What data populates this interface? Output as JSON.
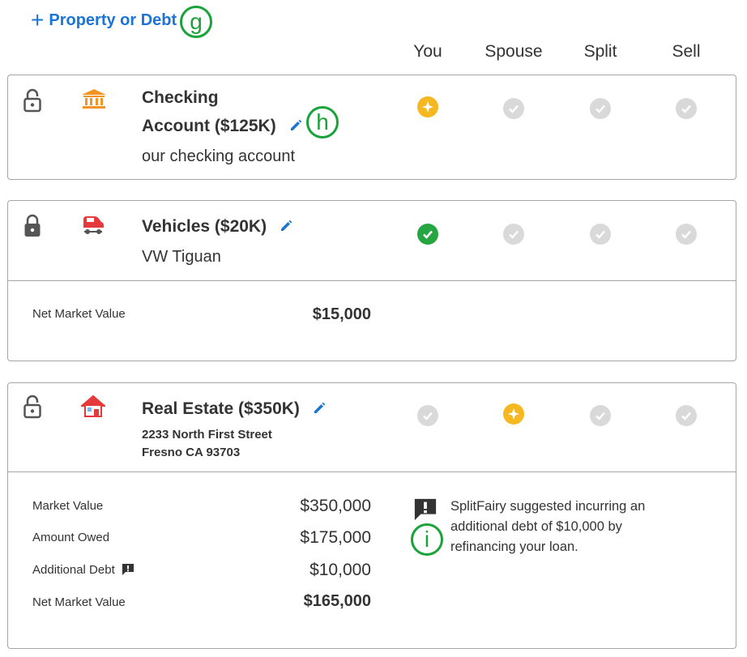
{
  "add_link": {
    "label": "Property or Debt"
  },
  "markers": {
    "g": "g",
    "h": "h",
    "i": "i"
  },
  "columns": [
    "You",
    "Spouse",
    "Split",
    "Sell"
  ],
  "colors": {
    "accent": "#1b74d6",
    "selected_green": "#26a640",
    "fairy_gold": "#f5b820",
    "unselected_gray": "#d9d9d9",
    "marker_green": "#1aa33a"
  },
  "cards": [
    {
      "locked": false,
      "icon": "bank-icon",
      "title_line1": "Checking",
      "title_line2": "Account ($125K)",
      "subtitle": "our checking account",
      "choices": [
        "fairy",
        "gray",
        "gray",
        "gray"
      ]
    },
    {
      "locked": true,
      "icon": "car-icon",
      "title_line1": "Vehicles ($20K)",
      "subtitle": "VW Tiguan",
      "choices": [
        "green",
        "gray",
        "gray",
        "gray"
      ],
      "details": [
        {
          "label": "Net Market Value",
          "value": "$15,000"
        }
      ]
    },
    {
      "locked": false,
      "icon": "house-icon",
      "title_line1": "Real Estate ($350K)",
      "address_line1": "2233 North First Street",
      "address_line2": "Fresno CA 93703",
      "choices": [
        "gray",
        "fairy",
        "gray",
        "gray"
      ],
      "details": [
        {
          "label": "Market Value",
          "value": "$350,000"
        },
        {
          "label": "Amount Owed",
          "value": "$175,000"
        },
        {
          "label": "Additional Debt",
          "value": "$10,000"
        },
        {
          "label": "Net Market Value",
          "value": "$165,000"
        }
      ],
      "note": "SplitFairy suggested incurring an additional debt of $10,000 by refinancing your loan."
    }
  ]
}
